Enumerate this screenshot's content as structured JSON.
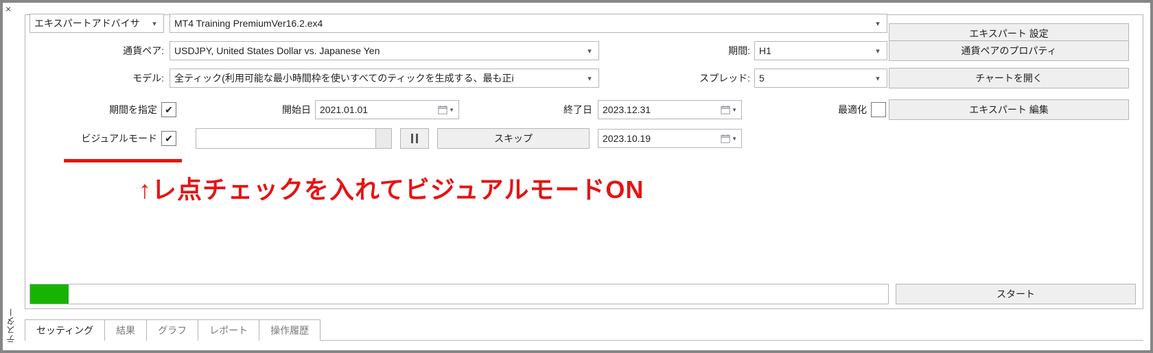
{
  "close_label": "×",
  "vertical_tab": "テスター",
  "ea_selector": "エキスパートアドバイサ",
  "ea_file": "MT4 Training PremiumVer16.2.ex4",
  "pair_label": "通貨ペア:",
  "pair_value": "USDJPY, United States Dollar vs. Japanese Yen",
  "period_label": "期間:",
  "period_value": "H1",
  "model_label": "モデル:",
  "model_value": "全ティック(利用可能な最小時間枠を使いすべてのティックを生成する、最も正i",
  "spread_label": "スプレッド:",
  "spread_value": "5",
  "use_period_label": "期間を指定",
  "use_period_checked": true,
  "from_label": "開始日",
  "from_value": "2021.01.01",
  "to_label": "終了日",
  "to_value": "2023.12.31",
  "optimize_label": "最適化",
  "optimize_checked": false,
  "visual_label": "ビジュアルモード",
  "visual_checked": true,
  "skip_label": "スキップ",
  "visual_date": "2023.10.19",
  "annotation_text": "↑レ点チェックを入れてビジュアルモードON",
  "start_label": "スタート",
  "right_buttons": {
    "expert_settings": "エキスパート 設定",
    "symbol_props": "通貨ペアのプロパティ",
    "open_chart": "チャートを開く",
    "expert_edit": "エキスパート 編集"
  },
  "tabs": {
    "settings": "セッティング",
    "results": "結果",
    "graph": "グラフ",
    "report": "レポート",
    "journal": "操作履歴"
  }
}
